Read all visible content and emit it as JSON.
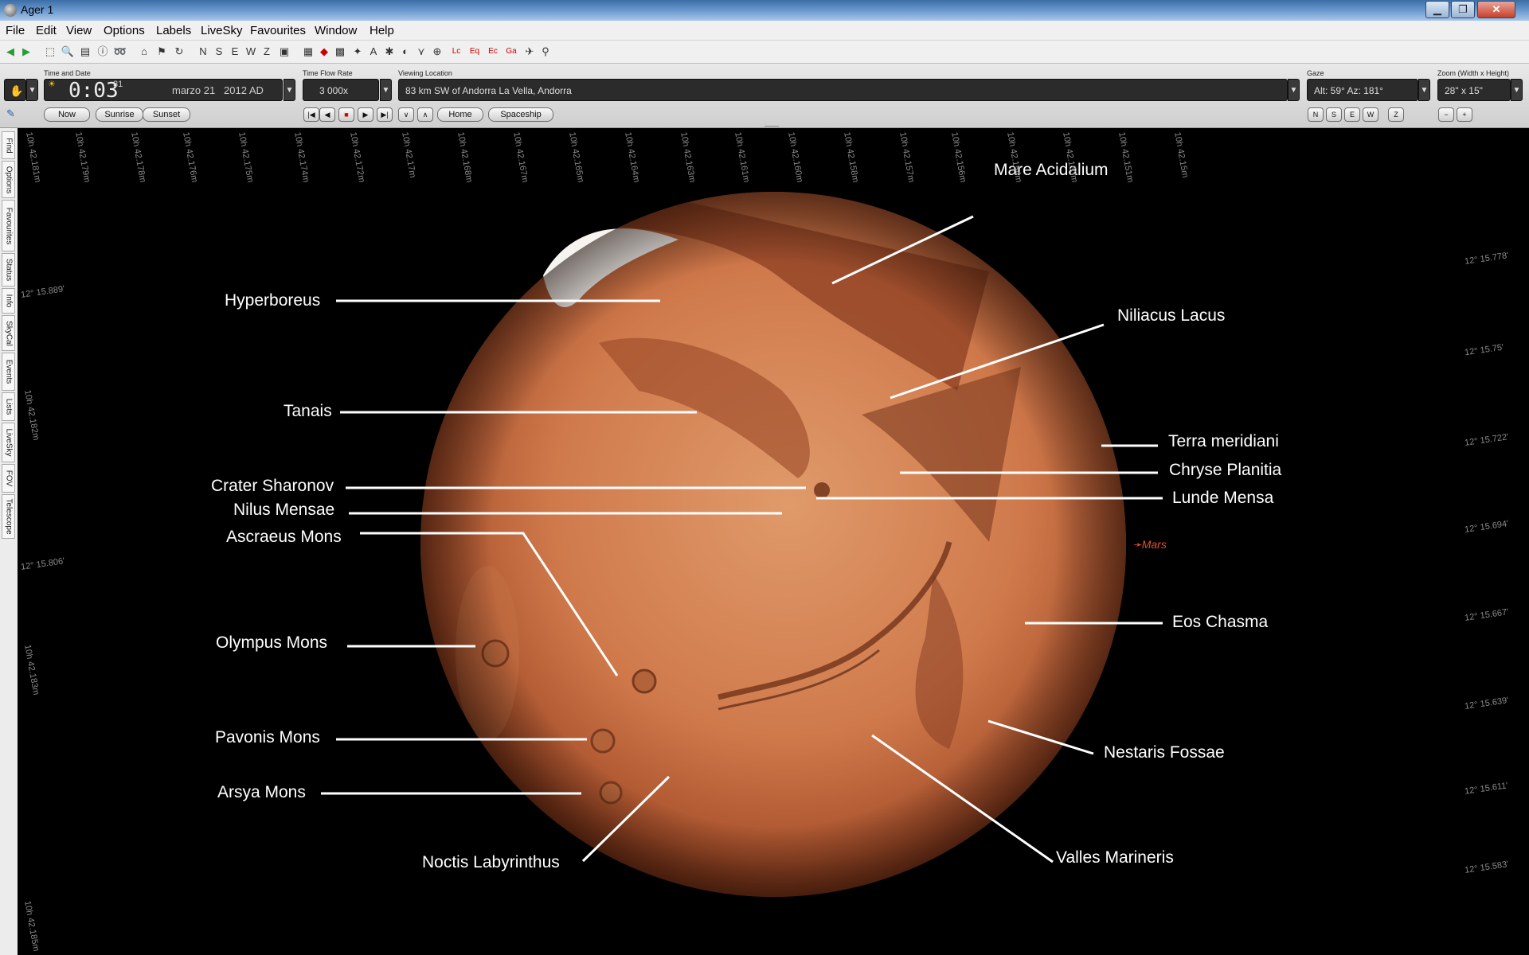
{
  "window": {
    "title": "Ager 1"
  },
  "menu": [
    "File",
    "Edit",
    "View",
    "Options",
    "Labels",
    "LiveSky",
    "Favourites",
    "Window",
    "Help"
  ],
  "toolbar_icons": [
    "back-icon",
    "forward-icon",
    "select-icon",
    "zoom-icon",
    "info-doc-icon",
    "info-icon",
    "path-icon",
    "home-icon",
    "flag-icon",
    "rotate-icon",
    "north-icon",
    "south-icon",
    "east-icon",
    "west-icon",
    "zenith-icon",
    "screen-icon",
    "chart-icon",
    "mark-icon",
    "grid-icon",
    "constellation-icon",
    "alt-az-icon",
    "star-icon",
    "planet-icon",
    "ecliptic-icon",
    "horizon-icon",
    "local-icon",
    "equatorial-icon",
    "ecliptic-grid-icon",
    "galactic-icon",
    "spaceship-icon",
    "telescope-icon"
  ],
  "time": {
    "label": "Time and Date",
    "time_value": "0:03",
    "seconds": "31",
    "date_value": "marzo 21   2012 AD",
    "buttons": [
      "Now",
      "Sunrise",
      "Sunset"
    ]
  },
  "flow": {
    "label": "Time Flow Rate",
    "value": "3 000x",
    "buttons": [
      "Home",
      "Spaceship"
    ]
  },
  "location": {
    "label": "Viewing Location",
    "value": "83 km SW of Andorra La Vella, Andorra"
  },
  "gaze": {
    "label": "Gaze",
    "value": "Alt: 59° Az: 181°",
    "buttons": [
      "N",
      "S",
      "E",
      "W",
      "Z"
    ]
  },
  "zoom": {
    "label": "Zoom (Width x Height)",
    "value": "28\" x 15\"",
    "minus": "−",
    "plus": "+"
  },
  "side_tabs": [
    "Find",
    "Options",
    "Favourites",
    "Status",
    "Info",
    "SkyCal",
    "Events",
    "Lists",
    "LiveSky",
    "FOV",
    "Telescope"
  ],
  "planet": {
    "name": "Mars",
    "features_left": [
      "Hyperboreus",
      "Tanais",
      "Crater Sharonov",
      "Nilus Mensae",
      "Ascraeus Mons",
      "Olympus Mons",
      "Pavonis Mons",
      "Arsya Mons",
      "Noctis Labyrinthus"
    ],
    "features_right": [
      "Mare Acidalium",
      "Niliacus Lacus",
      "Terra meridiani",
      "Chryse Planitia",
      "Lunde Mensa",
      "Eos Chasma",
      "Nestaris Fossae",
      "Valles Marineris"
    ]
  },
  "grid": {
    "ra_labels": [
      "10h 42.181m",
      "10h 42.179m",
      "10h 42.178m",
      "10h 42.176m",
      "10h 42.175m",
      "10h 42.174m",
      "10h 42.172m",
      "10h 42.17m",
      "10h 42.168m",
      "10h 42.167m",
      "10h 42.165m",
      "10h 42.164m",
      "10h 42.163m",
      "10h 42.161m",
      "10h 42.160m",
      "10h 42.158m",
      "10h 42.157m",
      "10h 42.156m",
      "10h 42.154m",
      "10h 42.153m",
      "10h 42.151m",
      "10h 42.15m"
    ],
    "dec_labels_right": [
      "12° 15.778'",
      "12° 15.75'",
      "12° 15.722'",
      "12° 15.694'",
      "12° 15.667'",
      "12° 15.639'",
      "12° 15.611'",
      "12° 15.583'"
    ],
    "dec_labels_left": [
      "12° 15.889'",
      "12° 15.806'"
    ],
    "ra_labels_left": [
      "10h 42.182m",
      "10h 42.183m",
      "10h 42.185m"
    ]
  },
  "colors": {
    "grid_line": "#5a0c0c",
    "label_text": "#ffffff",
    "mars_tag": "#e0502c"
  }
}
